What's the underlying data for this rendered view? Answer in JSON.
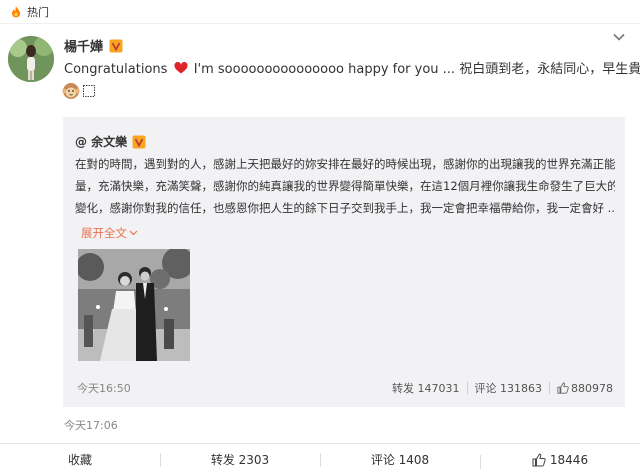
{
  "hot": {
    "label": "热门"
  },
  "post": {
    "username": "楊千嬅",
    "text_before_heart": "Congratulations ",
    "text_after_heart": " I'm sooooooooooooooo happy for you ... 祝白頭到老，永結同心，早生貴子",
    "time": "今天17:06"
  },
  "repost": {
    "author": "@ 余文樂",
    "lines": [
      "在對的時間，遇到對的人，感謝上天把最好的妳安排在最好的時候出現，感謝你的出現讓我的世界充滿正能",
      "量，充滿快樂，充滿笑聲，感謝你的純真讓我的世界變得簡單快樂，在這12個月裡你讓我生命發生了巨大的",
      "變化，感謝你對我的信任，也感恩你把人生的餘下日子交到我手上，我一定會把幸福帶給你，我一定會好  ..."
    ],
    "expand_label": "展开全文",
    "time": "今天16:50",
    "forward_label": "转发 147031",
    "comment_label": "评论  131863",
    "like_count": "880978"
  },
  "actions": {
    "favorite": "收藏",
    "forward": "转发 2303",
    "comment": "评论 1408",
    "like": "18446"
  },
  "colors": {
    "accent": "#eb7350",
    "repost_bg": "#f2f2f5",
    "badge": "#f6a623",
    "heart": "#e0222a"
  }
}
